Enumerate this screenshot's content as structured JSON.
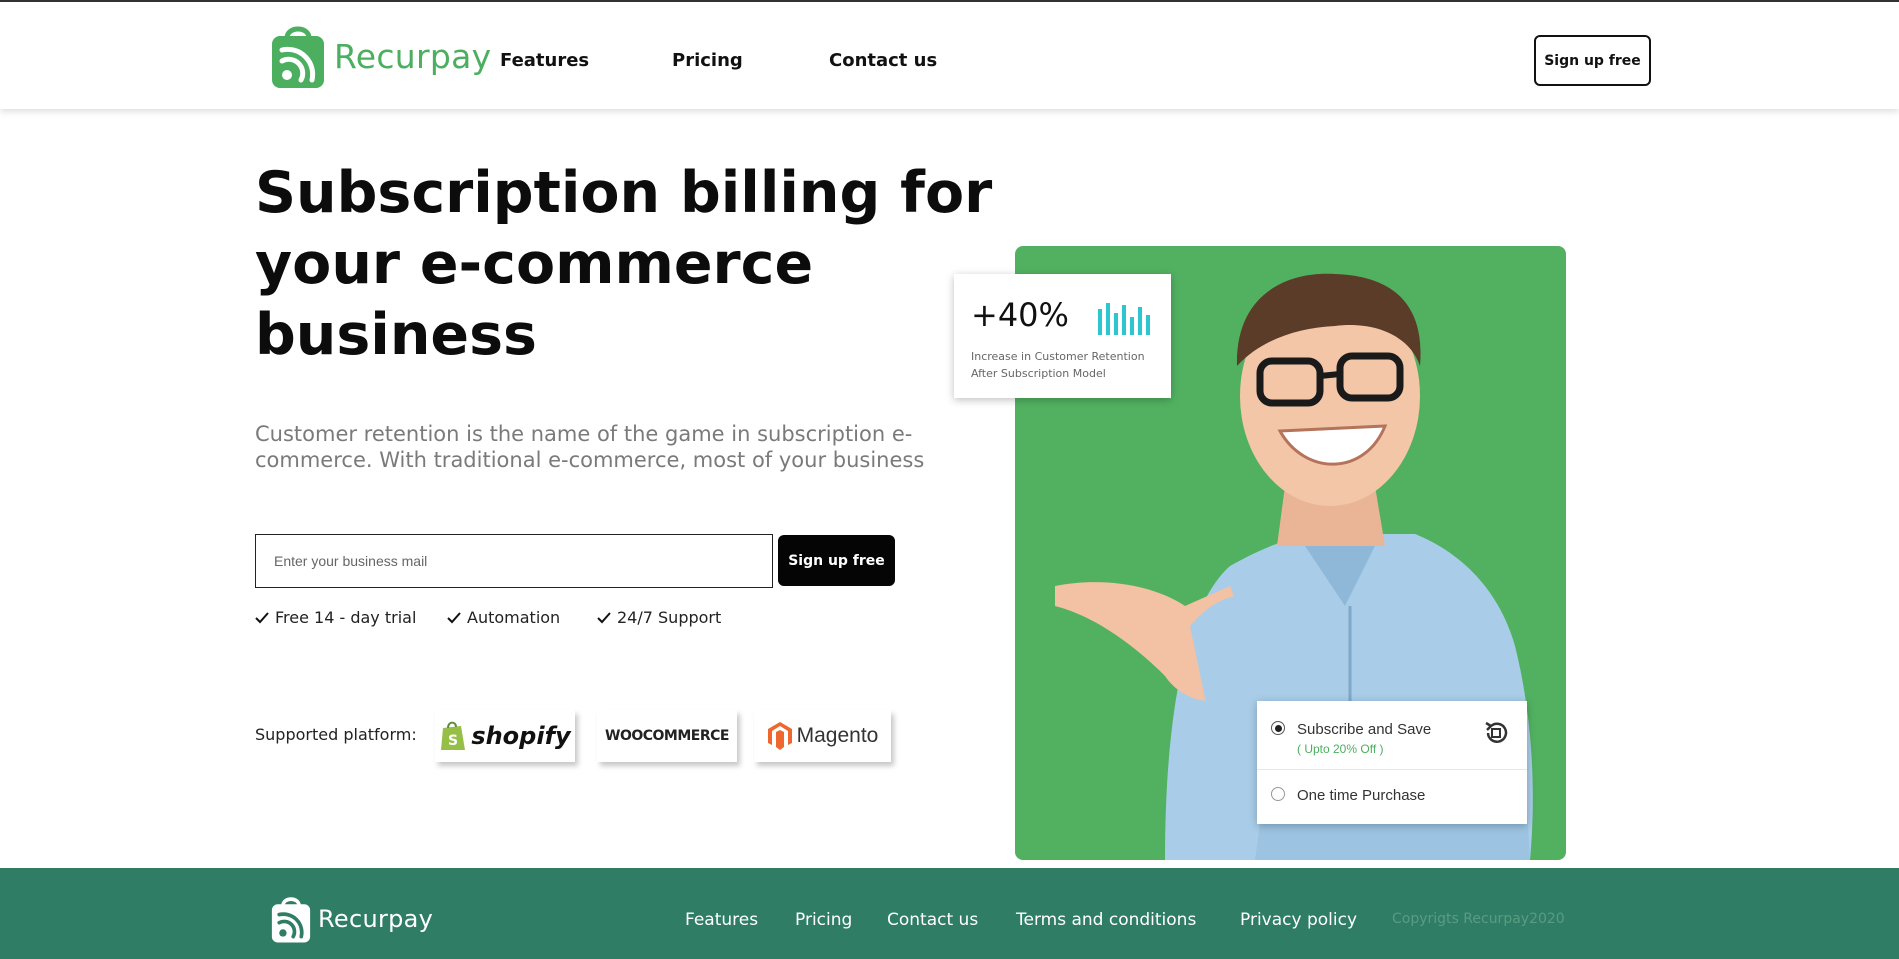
{
  "brand": {
    "name": "Recurpay",
    "color": "#4caf5f",
    "footer_color": "#2e7d64"
  },
  "header": {
    "nav": [
      "Features",
      "Pricing",
      "Contact us"
    ],
    "cta_label": "Sign up free"
  },
  "hero": {
    "headline": "Subscription billing for your e-commerce business",
    "lead": "Customer retention is the name of the game in subscription e-commerce. With traditional e-commerce, most of your business",
    "email_placeholder": "Enter your business mail",
    "cta_label": "Sign up free",
    "perks": [
      "Free 14 - day trial",
      "Automation",
      "24/7 Support"
    ],
    "platform_label": "Supported platform:",
    "platforms": [
      "shopify",
      "WOOCOMMERCE",
      "Magento"
    ]
  },
  "visual": {
    "panel_color": "#52b161",
    "stat_value": "+40%",
    "stat_caption_line1": "Increase in Customer Retention",
    "stat_caption_line2": "After Subscription Model",
    "options": [
      {
        "label": "Subscribe and Save",
        "sublabel": "( Upto 20% Off )",
        "selected": true
      },
      {
        "label": "One time Purchase",
        "selected": false
      }
    ]
  },
  "footer": {
    "links": [
      "Features",
      "Pricing",
      "Contact us",
      "Terms and conditions",
      "Privacy policy"
    ],
    "copyright": "Copyrigts Recurpay2020"
  }
}
